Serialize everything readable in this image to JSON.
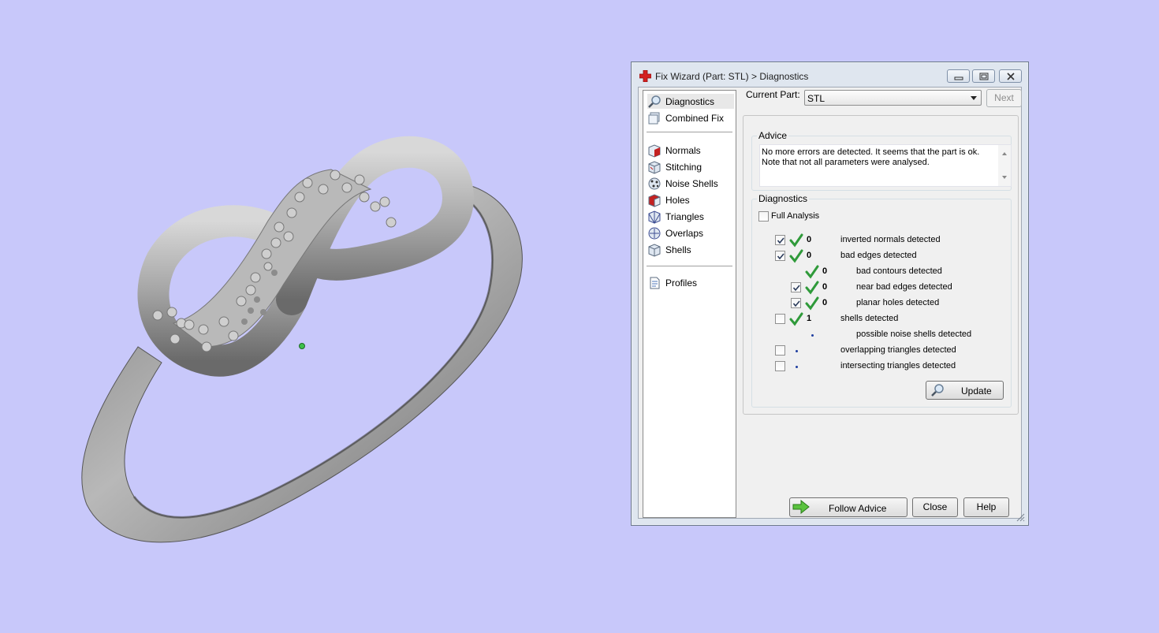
{
  "colors": {
    "background": "#c8c8fa",
    "ring": "#9a9a9a",
    "check_green": "#2f9a3a",
    "dot_blue": "#1f3ea0"
  },
  "window": {
    "title": "Fix Wizard (Part: STL) > Diagnostics",
    "title_icon": "red-cross-icon",
    "controls": [
      "minimize-icon",
      "restore-icon",
      "close-icon"
    ]
  },
  "nav": {
    "items": [
      {
        "label": "Diagnostics",
        "icon": "magnifier-icon",
        "selected": true
      },
      {
        "label": "Combined Fix",
        "icon": "combined-fix-icon"
      },
      {
        "label": "Normals",
        "icon": "normals-cube-icon"
      },
      {
        "label": "Stitching",
        "icon": "stitching-cube-icon"
      },
      {
        "label": "Noise Shells",
        "icon": "noise-shells-icon"
      },
      {
        "label": "Holes",
        "icon": "holes-cube-icon"
      },
      {
        "label": "Triangles",
        "icon": "triangles-cube-icon"
      },
      {
        "label": "Overlaps",
        "icon": "overlaps-icon"
      },
      {
        "label": "Shells",
        "icon": "shells-cube-icon"
      },
      {
        "label": "Profiles",
        "icon": "document-icon"
      }
    ]
  },
  "current_part": {
    "label": "Current Part:",
    "value": "STL",
    "next_label": "Next"
  },
  "advice": {
    "title": "Advice",
    "text": "No more errors are detected. It seems that the part is ok.\nNote that not all parameters were analysed."
  },
  "diagnostics": {
    "title": "Diagnostics",
    "full_analysis_label": "Full Analysis",
    "full_analysis_checked": false,
    "rows": [
      {
        "label": "inverted normals detected",
        "count": "0",
        "checkbox": true,
        "checked": true,
        "status": "ok",
        "indent": 0
      },
      {
        "label": "bad edges detected",
        "count": "0",
        "checkbox": true,
        "checked": true,
        "status": "ok",
        "indent": 0
      },
      {
        "label": "bad contours detected",
        "count": "0",
        "checkbox": false,
        "checked": false,
        "status": "ok",
        "indent": 1
      },
      {
        "label": "near bad edges detected",
        "count": "0",
        "checkbox": true,
        "checked": true,
        "status": "ok",
        "indent": 1
      },
      {
        "label": "planar holes detected",
        "count": "0",
        "checkbox": true,
        "checked": true,
        "status": "ok",
        "indent": 1
      },
      {
        "label": "shells detected",
        "count": "1",
        "checkbox": true,
        "checked": false,
        "status": "ok",
        "indent": 0
      },
      {
        "label": "possible noise shells detected",
        "count": "",
        "checkbox": false,
        "checked": false,
        "status": "dot",
        "indent": 1
      },
      {
        "label": "overlapping triangles detected",
        "count": "",
        "checkbox": true,
        "checked": false,
        "status": "dot",
        "indent": 0
      },
      {
        "label": "intersecting triangles detected",
        "count": "",
        "checkbox": true,
        "checked": false,
        "status": "dot",
        "indent": 0
      }
    ],
    "update_label": "Update"
  },
  "footer": {
    "follow_advice_label": "Follow Advice",
    "close_label": "Close",
    "help_label": "Help"
  }
}
